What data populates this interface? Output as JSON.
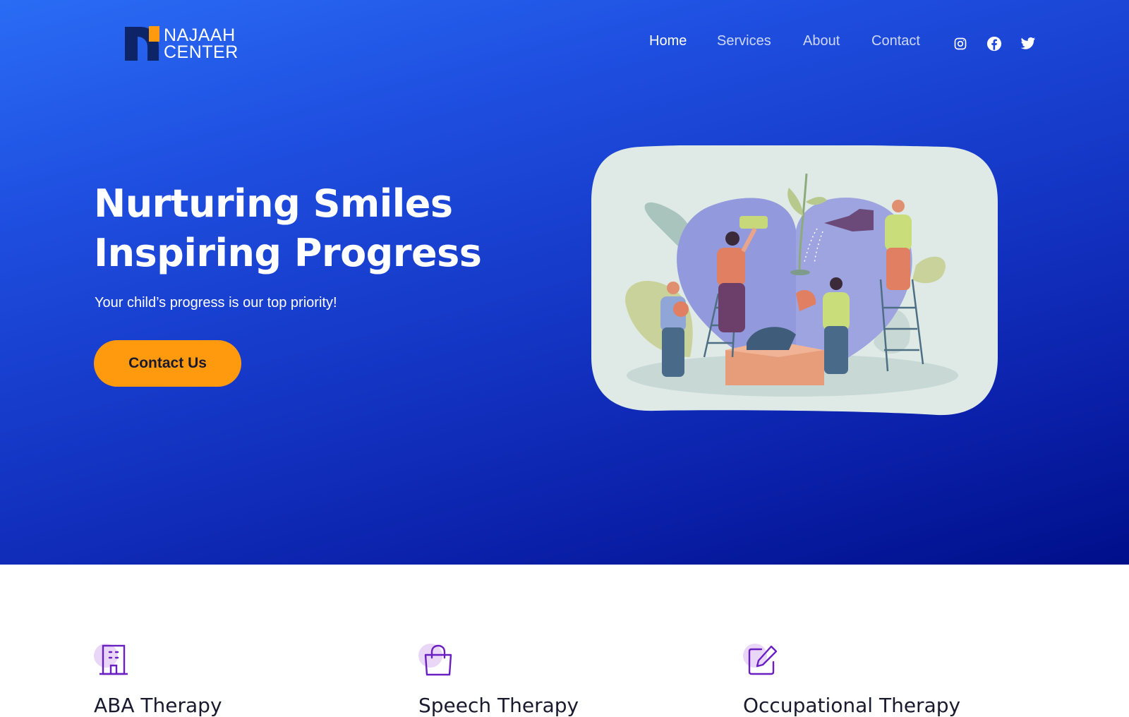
{
  "brand": {
    "line1": "NAJAAH",
    "line2": "CENTER"
  },
  "nav": {
    "items": [
      {
        "label": "Home",
        "active": true
      },
      {
        "label": "Services",
        "active": false
      },
      {
        "label": "About",
        "active": false
      },
      {
        "label": "Contact",
        "active": false
      }
    ],
    "social": [
      "instagram-icon",
      "facebook-icon",
      "twitter-icon"
    ]
  },
  "hero": {
    "headline_line1": "Nurturing Smiles",
    "headline_line2": "Inspiring Progress",
    "subtitle": "Your child’s progress is our top priority!",
    "cta_label": "Contact Us"
  },
  "services": [
    {
      "title": "ABA Therapy",
      "icon": "building-icon"
    },
    {
      "title": "Speech Therapy",
      "icon": "shopping-bag-icon"
    },
    {
      "title": "Occupational Therapy",
      "icon": "edit-icon"
    }
  ],
  "colors": {
    "hero_top": "#2a6cf5",
    "hero_bottom": "#000f8a",
    "accent_orange": "#ff9a0e",
    "icon_purple": "#6a1fc2",
    "icon_dot": "#ead7f7"
  }
}
